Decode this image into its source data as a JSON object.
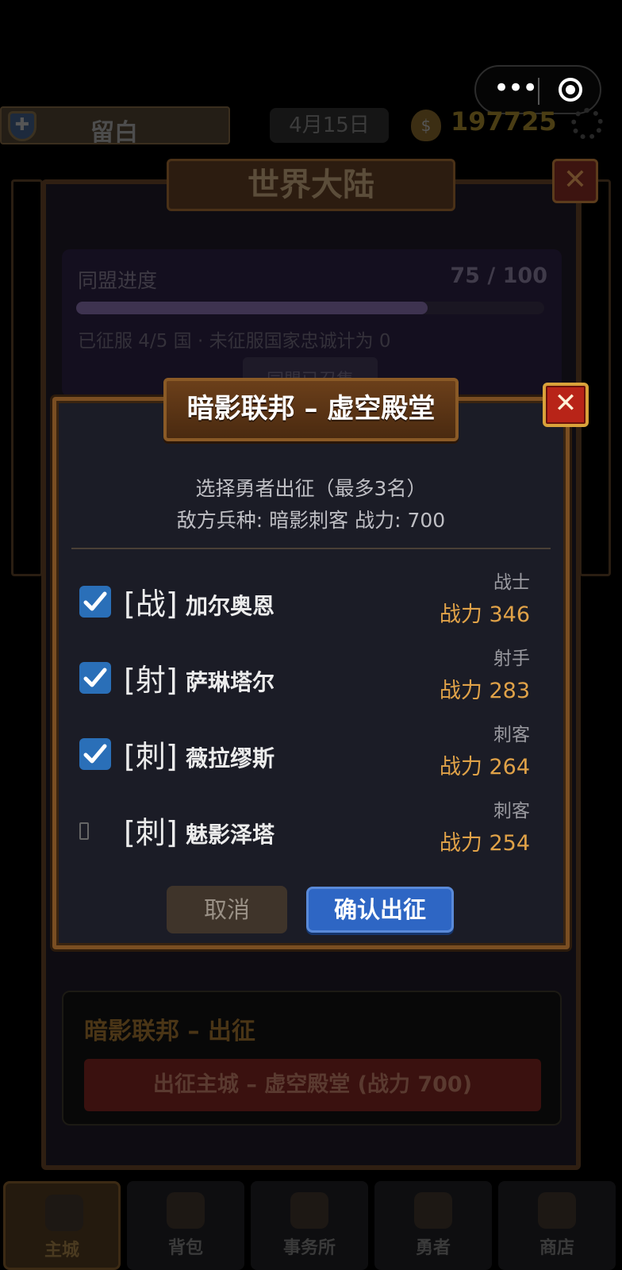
{
  "top_bar": {
    "username": "留白",
    "date": "4月15日",
    "coins": "197725"
  },
  "world": {
    "title": "世界大陆",
    "close_symbol": "✕",
    "alliance": {
      "label": "同盟进度",
      "progress_text": "75 / 100",
      "progress_fraction": 0.75,
      "summary": "已征服 4/5 国 · 未征服国家忠诚计为 0",
      "recruit_label": "同盟已召集"
    },
    "march": {
      "title": "暗影联邦 – 出征",
      "button_label": "出征主城 – 虚空殿堂 (战力 700)"
    }
  },
  "dialog": {
    "title": "暗影联邦 – 虚空殿堂",
    "close_symbol": "✕",
    "instruction": "选择勇者出征（最多3名）",
    "enemy_info": "敌方兵种: 暗影刺客  战力: 700",
    "heroes": [
      {
        "class_tag": "[战]",
        "name": "加尔奥恩",
        "role": "战士",
        "power": "战力 346",
        "checked": true
      },
      {
        "class_tag": "[射]",
        "name": "萨琳塔尔",
        "role": "射手",
        "power": "战力 283",
        "checked": true
      },
      {
        "class_tag": "[刺]",
        "name": "薇拉缪斯",
        "role": "刺客",
        "power": "战力 264",
        "checked": true
      },
      {
        "class_tag": "[刺]",
        "name": "魅影泽塔",
        "role": "刺客",
        "power": "战力 254",
        "checked": false
      }
    ],
    "cancel_label": "取消",
    "confirm_label": "确认出征"
  },
  "nav": [
    {
      "label": "主城",
      "icon": "castle-icon",
      "active": true
    },
    {
      "label": "背包",
      "icon": "bag-icon",
      "active": false
    },
    {
      "label": "事务所",
      "icon": "shield-icon",
      "active": false
    },
    {
      "label": "勇者",
      "icon": "hero-icon",
      "active": false
    },
    {
      "label": "商店",
      "icon": "shop-icon",
      "active": false
    }
  ],
  "colors": {
    "accent_gold": "#e0a248",
    "confirm_blue": "#2e66c4",
    "close_red": "#b82418",
    "checkbox_blue": "#2a6fb8"
  }
}
